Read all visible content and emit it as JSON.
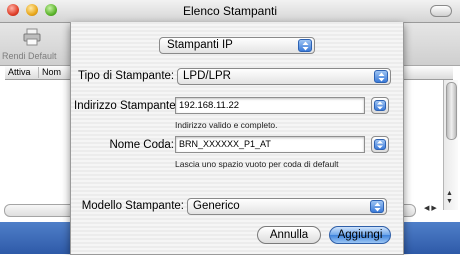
{
  "window": {
    "title": "Elenco Stampanti"
  },
  "toolbar": {
    "add_default_label": "Rendi Default"
  },
  "list": {
    "headers": [
      "Attiva",
      "Nom"
    ]
  },
  "sheet": {
    "connection_popup": "Stampanti IP",
    "printer_type": {
      "label": "Tipo di Stampante:",
      "value": "LPD/LPR"
    },
    "address": {
      "label": "Indirizzo Stampante:",
      "value": "192.168.11.22",
      "hint": "Indirizzo valido e completo."
    },
    "queue": {
      "label": "Nome Coda:",
      "value": "BRN_XXXXXX_P1_AT",
      "hint": "Lascia uno spazio vuoto per coda di default"
    },
    "model": {
      "label": "Modello Stampante:",
      "value": "Generico"
    },
    "buttons": {
      "cancel": "Annulla",
      "add": "Aggiungi"
    }
  },
  "colors": {
    "accent": "#3b7ad8",
    "desktop_band": "#3d6cbf"
  }
}
